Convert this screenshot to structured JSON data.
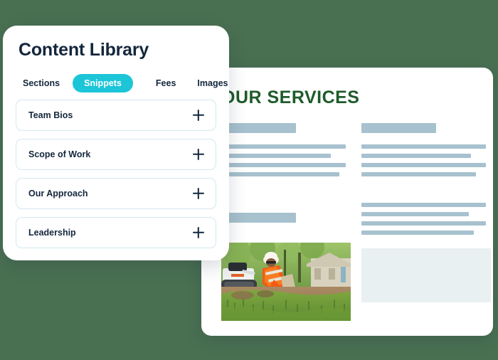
{
  "colors": {
    "backdrop_green": "#4a7052",
    "accent_teal": "#1cc5d8",
    "heading_green": "#1e5b2a",
    "text_navy": "#13263c",
    "placeholder_blue": "#a7c1ce",
    "placeholder_box": "#e9f0f2",
    "card_border": "#d3e8f0"
  },
  "card": {
    "title": "Content Library",
    "tabs": [
      {
        "label": "Sections",
        "active": false
      },
      {
        "label": "Snippets",
        "active": true
      },
      {
        "label": "Fees",
        "active": false
      },
      {
        "label": "Images",
        "active": false
      }
    ],
    "items": [
      {
        "label": "Team Bios",
        "action_icon": "plus-icon"
      },
      {
        "label": "Scope of Work",
        "action_icon": "plus-icon"
      },
      {
        "label": "Our Approach",
        "action_icon": "plus-icon"
      },
      {
        "label": "Leadership",
        "action_icon": "plus-icon"
      }
    ]
  },
  "document": {
    "heading": "OUR SERVICES",
    "photo_alt": "landscaping-worker-photo",
    "left_column": {
      "heading_block_widths": [
        "60%",
        "60%"
      ],
      "line_widths": [
        "100%",
        "88%",
        "100%",
        "95%"
      ]
    },
    "right_column": {
      "heading_block_widths": [
        "60%"
      ],
      "line_widths_top": [
        "100%",
        "88%",
        "100%",
        "92%"
      ],
      "line_widths_bottom": [
        "100%",
        "86%",
        "100%",
        "90%"
      ]
    }
  }
}
